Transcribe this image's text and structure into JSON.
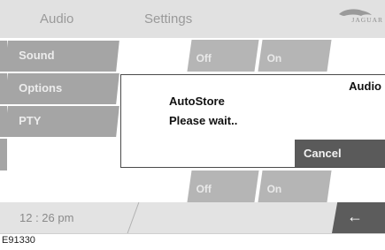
{
  "header": {
    "tab_audio": "Audio",
    "tab_settings": "Settings",
    "logo_text": "JAGUAR"
  },
  "menu": {
    "items": [
      {
        "label": "Sound"
      },
      {
        "label": "Options"
      },
      {
        "label": "PTY"
      }
    ]
  },
  "toggles": {
    "row1_off": "Off",
    "row1_on": "On",
    "row2_off": "Off",
    "row2_on": "On"
  },
  "dialog": {
    "title": "Audio",
    "line1": "AutoStore",
    "line2": "Please wait..",
    "cancel_label": "Cancel"
  },
  "status": {
    "time": "12 : 26 pm",
    "back_icon": "←"
  },
  "caption": "E91330",
  "colors": {
    "bar": "#e1e1e1",
    "menu": "#a5a5a5",
    "button_dark": "#5a5a5a"
  }
}
